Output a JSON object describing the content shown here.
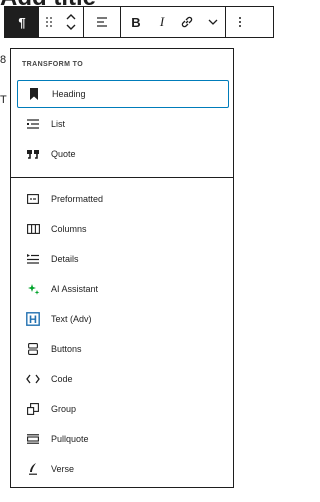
{
  "background": {
    "title_fragment": "Add title",
    "left_fragments": [
      "8",
      "T"
    ]
  },
  "toolbar": {
    "paragraph_icon": "paragraph-icon",
    "drag_icon": "drag-handle-icon",
    "move_icon": "move-up-down-icon",
    "align_icon": "align-icon",
    "bold_label": "B",
    "italic_label": "I",
    "link_icon": "link-icon",
    "more_rich_icon": "chevron-down-icon",
    "options_icon": "more-vertical-icon",
    "active_color": "#1e1e1e"
  },
  "dropdown": {
    "section_label": "TRANSFORM TO",
    "group1": [
      {
        "label": "Heading",
        "icon": "bookmark-icon",
        "selected": true
      },
      {
        "label": "List",
        "icon": "list-icon"
      },
      {
        "label": "Quote",
        "icon": "quote-icon"
      }
    ],
    "group2": [
      {
        "label": "Preformatted",
        "icon": "preformatted-icon"
      },
      {
        "label": "Columns",
        "icon": "columns-icon"
      },
      {
        "label": "Details",
        "icon": "details-icon"
      },
      {
        "label": "AI Assistant",
        "icon": "ai-sparkle-icon",
        "color": "#00a32a"
      },
      {
        "label": "Text (Adv)",
        "icon": "text-adv-icon",
        "color": "#2271b1"
      },
      {
        "label": "Buttons",
        "icon": "buttons-icon"
      },
      {
        "label": "Code",
        "icon": "code-icon"
      },
      {
        "label": "Group",
        "icon": "group-icon"
      },
      {
        "label": "Pullquote",
        "icon": "pullquote-icon"
      },
      {
        "label": "Verse",
        "icon": "verse-icon"
      }
    ],
    "accent_color": "#007cba"
  }
}
